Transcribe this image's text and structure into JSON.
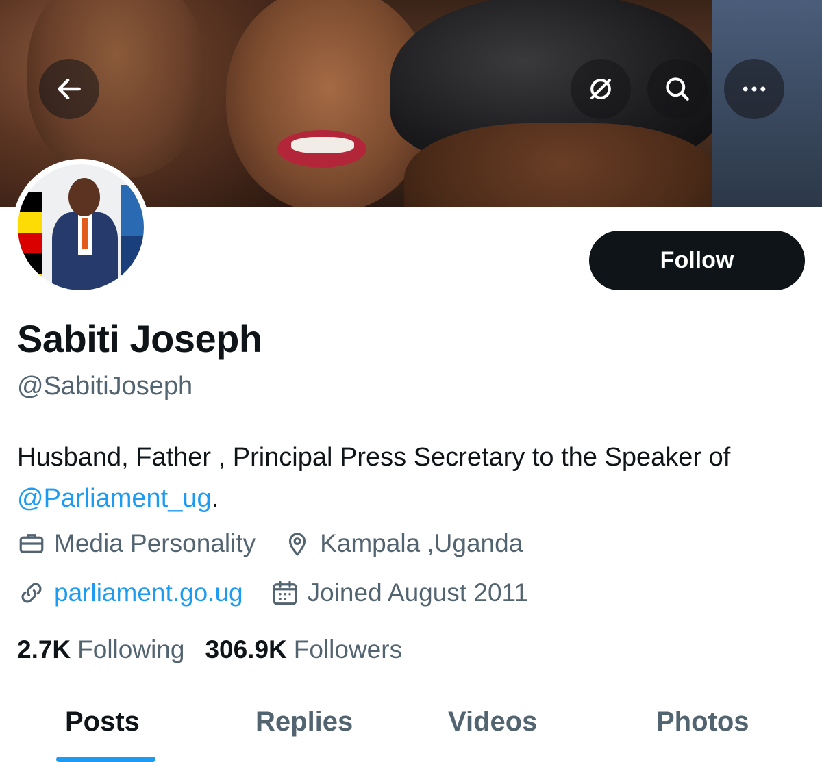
{
  "header": {
    "back_icon": "arrow-left-icon",
    "actions": [
      "broken-link-icon",
      "search-icon",
      "more-icon"
    ]
  },
  "profile": {
    "name": "Sabiti Joseph",
    "handle": "@SabitiJoseph",
    "bio_prefix": "Husband, Father , Principal Press Secretary to the Speaker of ",
    "bio_mention": "@Parliament_ug",
    "bio_suffix": ".",
    "category": "Media Personality",
    "location": "Kampala ,Uganda",
    "website": "parliament.go.ug",
    "joined": "Joined August 2011"
  },
  "follow_button": {
    "label": "Follow"
  },
  "stats": {
    "following_count": "2.7K",
    "following_label": "Following",
    "followers_count": "306.9K",
    "followers_label": "Followers"
  },
  "tabs": [
    {
      "label": "Posts",
      "active": true
    },
    {
      "label": "Replies",
      "active": false
    },
    {
      "label": "Videos",
      "active": false
    },
    {
      "label": "Photos",
      "active": false
    }
  ],
  "colors": {
    "accent": "#1d9bf0",
    "text_primary": "#0f1419",
    "text_secondary": "#536471",
    "button_dark": "#0f1419"
  }
}
